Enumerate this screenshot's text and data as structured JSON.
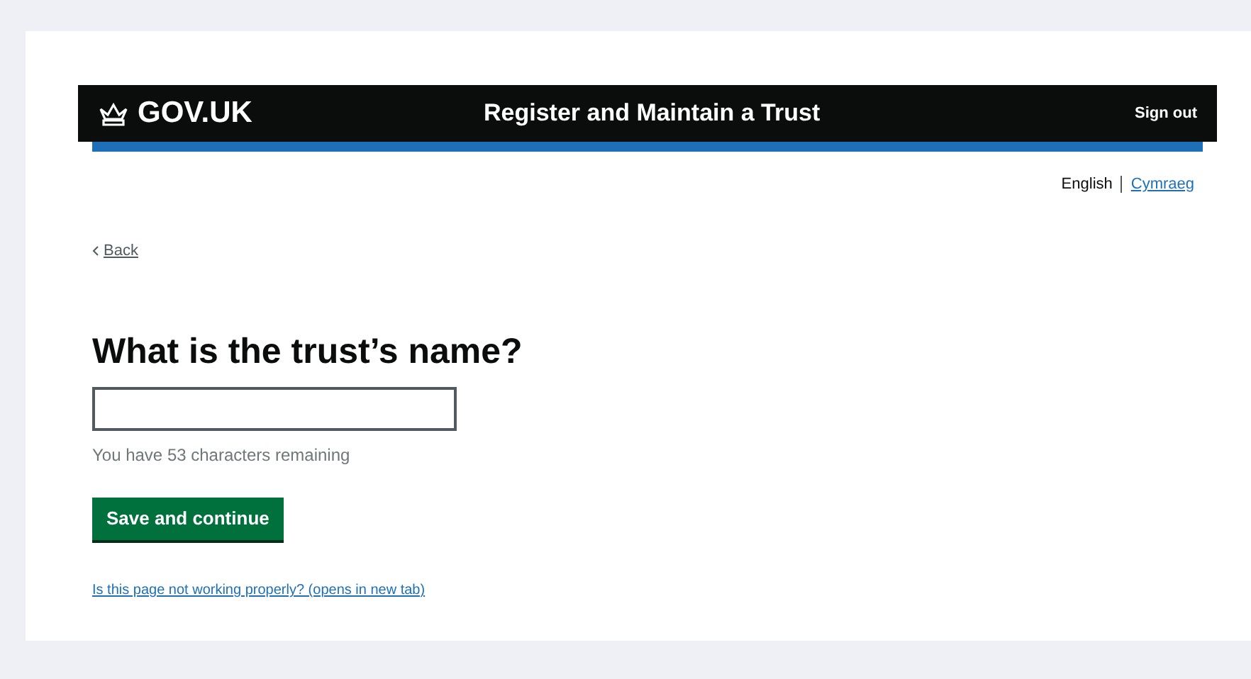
{
  "header": {
    "logo": "GOV.UK",
    "service_name": "Register and Maintain a Trust",
    "sign_out": "Sign out"
  },
  "languages": [
    {
      "label": "English",
      "selected": true
    },
    {
      "label": "Cymraeg",
      "selected": false
    }
  ],
  "back_link": "Back",
  "question": "What is the trust’s name?",
  "hint": "You have 53 characters remaining",
  "button": "Save and continue",
  "help_link": "Is this page not working properly? (opens in new tab)"
}
